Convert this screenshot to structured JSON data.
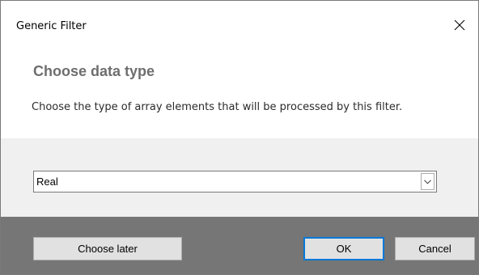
{
  "window": {
    "title": "Generic Filter"
  },
  "header": {
    "heading": "Choose data type",
    "description": "Choose the type of array elements that will be processed by this filter."
  },
  "data_type_select": {
    "selected": "Real"
  },
  "footer": {
    "choose_later_label": "Choose later",
    "ok_label": "OK",
    "cancel_label": "Cancel"
  },
  "icons": {
    "close": "close-icon",
    "dropdown": "chevron-down-icon"
  },
  "colors": {
    "footer_bg": "#767676",
    "content_bg": "#f0f0f0",
    "heading": "#6e6e6e",
    "focus_border": "#0078d7"
  }
}
